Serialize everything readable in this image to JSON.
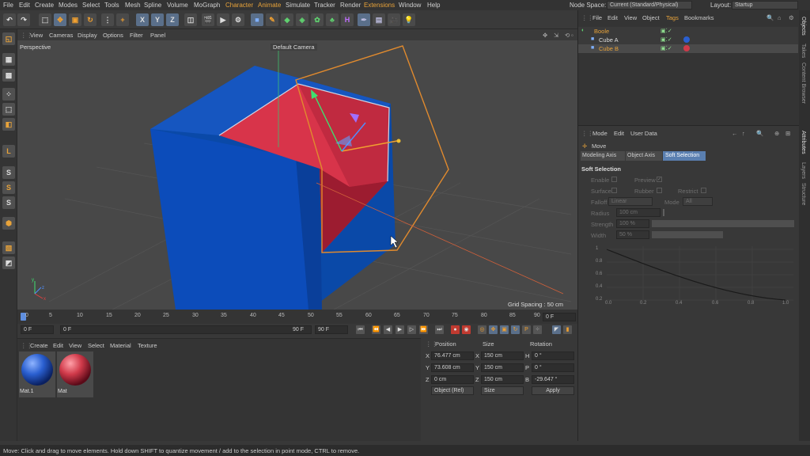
{
  "menubar": {
    "items": [
      "File",
      "Edit",
      "Create",
      "Modes",
      "Select",
      "Tools",
      "Mesh",
      "Spline",
      "Volume",
      "MoGraph",
      "Character",
      "Animate",
      "Simulate",
      "Tracker",
      "Render",
      "Extensions",
      "Window",
      "Help"
    ],
    "node_space_label": "Node Space:",
    "node_space_value": "Current (Standard/Physical)",
    "layout_label": "Layout:",
    "layout_value": "Startup"
  },
  "toolbar": {
    "x_label": "X",
    "y_label": "Y",
    "z_label": "Z"
  },
  "viewport": {
    "menu": [
      "View",
      "Cameras",
      "Display",
      "Options",
      "Filter",
      "Panel"
    ],
    "label": "Perspective",
    "camera": "Default Camera",
    "grid_spacing": "Grid Spacing : 50 cm"
  },
  "timeline": {
    "ticks": [
      "0",
      "5",
      "10",
      "15",
      "20",
      "25",
      "30",
      "35",
      "40",
      "45",
      "50",
      "55",
      "60",
      "65",
      "70",
      "75",
      "80",
      "85",
      "90"
    ],
    "frame_field": "0 F"
  },
  "playbar": {
    "start": "0 F",
    "current": "0 F",
    "end": "90 F",
    "end2": "90 F"
  },
  "materials": {
    "menu": [
      "Create",
      "Edit",
      "View",
      "Select",
      "Material",
      "Texture"
    ],
    "items": [
      {
        "name": "Mat.1",
        "color": "#2a5fd0"
      },
      {
        "name": "Mat",
        "color": "#d03a4a"
      }
    ]
  },
  "coords": {
    "headers": {
      "position": "Position",
      "size": "Size",
      "rotation": "Rotation"
    },
    "rows": [
      {
        "axis": "X",
        "pos": "76.477 cm",
        "saxis": "X",
        "size": "150 cm",
        "raxis": "H",
        "rot": "0 °"
      },
      {
        "axis": "Y",
        "pos": "73.608 cm",
        "saxis": "Y",
        "size": "150 cm",
        "raxis": "P",
        "rot": "0 °"
      },
      {
        "axis": "Z",
        "pos": "0 cm",
        "saxis": "Z",
        "size": "150 cm",
        "raxis": "B",
        "rot": "-29.647 °"
      }
    ],
    "mode": "Object (Rel)",
    "size_mode": "Size",
    "apply": "Apply"
  },
  "objects": {
    "menu": [
      "File",
      "Edit",
      "View",
      "Object",
      "Tags",
      "Bookmarks"
    ],
    "items": [
      "Boole",
      "Cube A",
      "Cube B"
    ]
  },
  "attributes": {
    "menu": [
      "Mode",
      "Edit",
      "User Data"
    ],
    "tool": "Move",
    "tabs": [
      "Modeling Axis",
      "Object Axis",
      "Soft Selection"
    ],
    "section": "Soft Selection",
    "enable": "Enable",
    "preview": "Preview",
    "surface": "Surface",
    "rubber": "Rubber",
    "restrict": "Restrict",
    "falloff_label": "Falloff",
    "falloff_value": "Linear",
    "mode_label": "Mode",
    "mode_value": "All",
    "radius_label": "Radius",
    "radius_value": "100 cm",
    "strength_label": "Strength",
    "strength_value": "100 %",
    "width_label": "Width",
    "width_value": "50 %",
    "graph_y": [
      "1",
      "0.8",
      "0.6",
      "0.4",
      "0.2"
    ],
    "graph_x": [
      "0.0",
      "0.2",
      "0.4",
      "0.6",
      "0.8",
      "1.0"
    ]
  },
  "sidetabs": [
    "Objects",
    "Takes",
    "Content Browser",
    "Attributes",
    "Layers",
    "Structure"
  ],
  "status": "Move: Click and drag to move elements. Hold down SHIFT to quantize movement / add to the selection in point mode, CTRL to remove."
}
